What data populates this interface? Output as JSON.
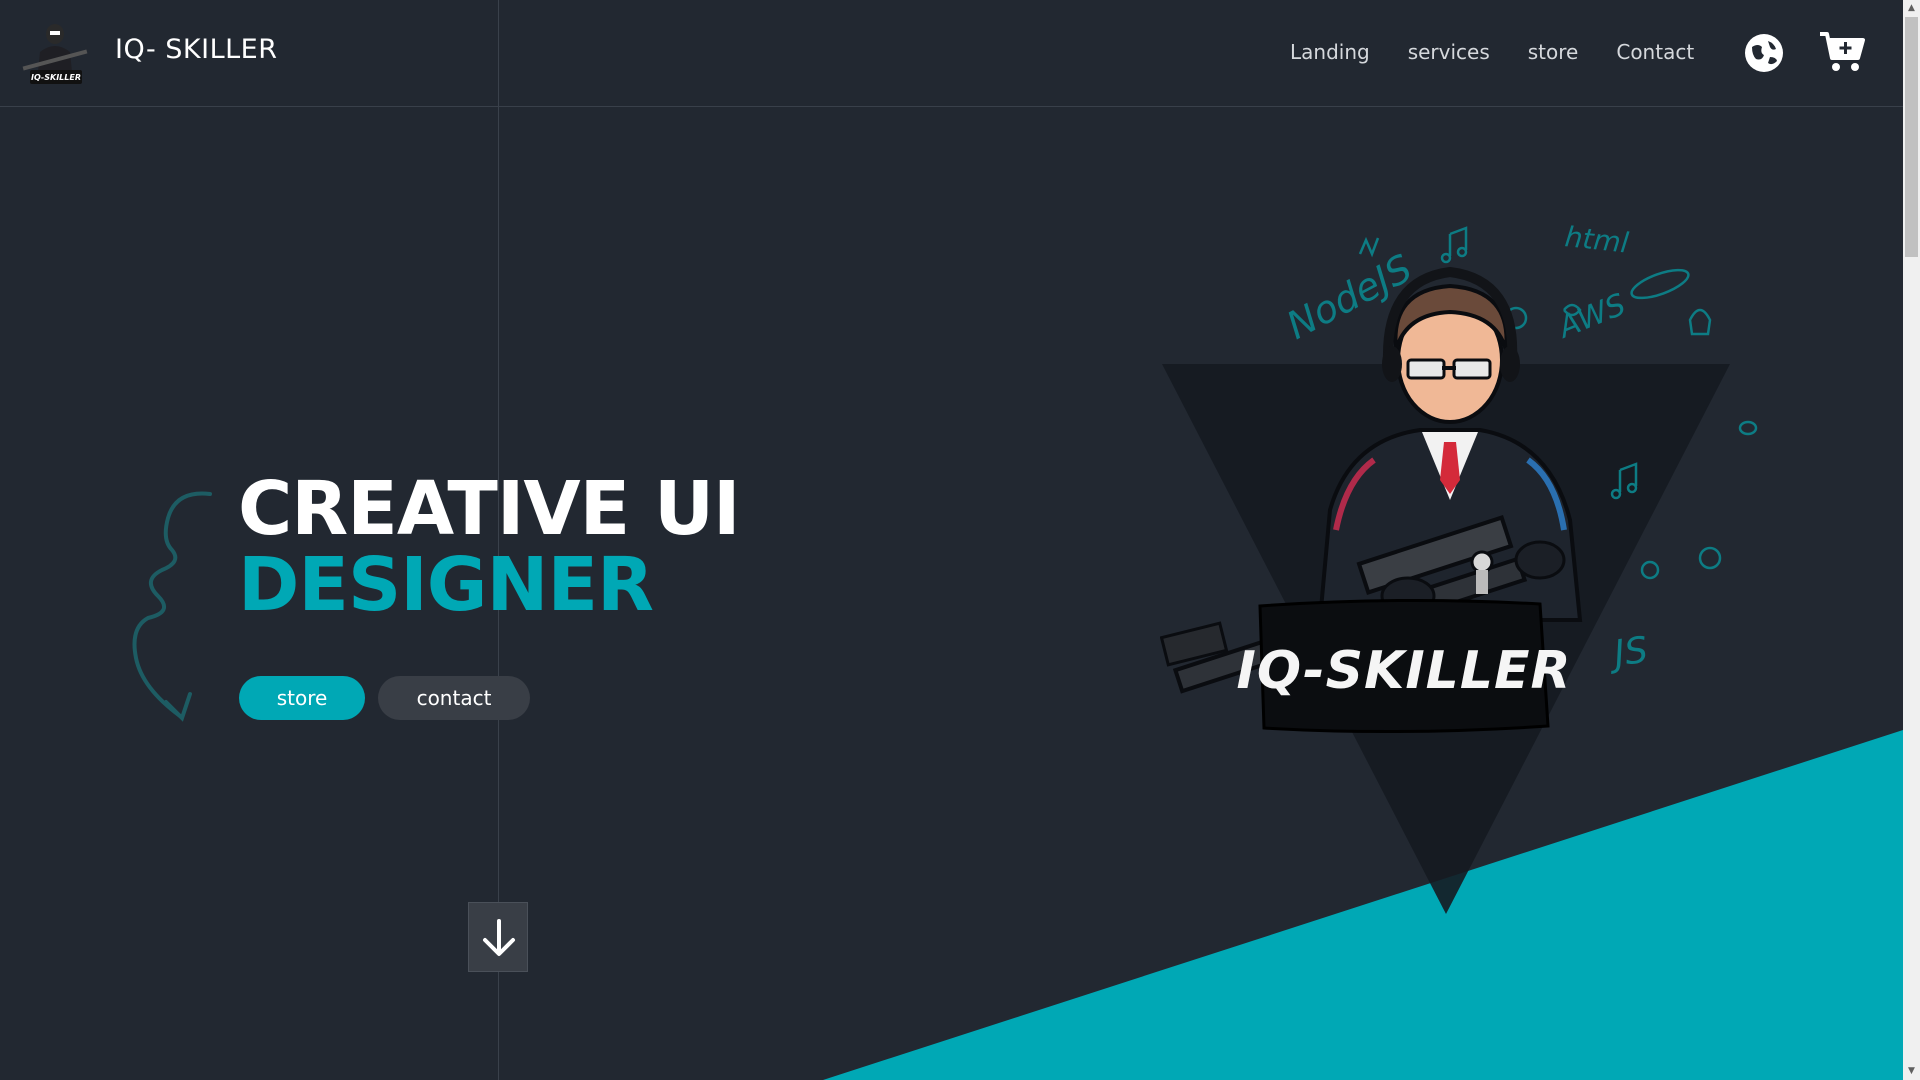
{
  "header": {
    "brand": "IQ- SKILLER",
    "logo_text": "IQ-SKILLER",
    "nav": [
      "Landing",
      "services",
      "store",
      "Contact"
    ],
    "icons": [
      "globe-icon",
      "cart-icon"
    ]
  },
  "hero": {
    "line1": "CREATIVE UI",
    "line2": "DESIGNER",
    "buttons": {
      "store": "store",
      "contact": "contact"
    },
    "scroll_button_icon": "arrow-down-icon"
  },
  "illustration": {
    "banner_text": "IQ-SKILLER",
    "doodles": [
      "NodeJS",
      "html",
      "AWS",
      "JS"
    ]
  },
  "colors": {
    "background": "#222831",
    "accent": "#00a8b5",
    "secondary_button": "#393e46",
    "text": "#ffffff"
  }
}
